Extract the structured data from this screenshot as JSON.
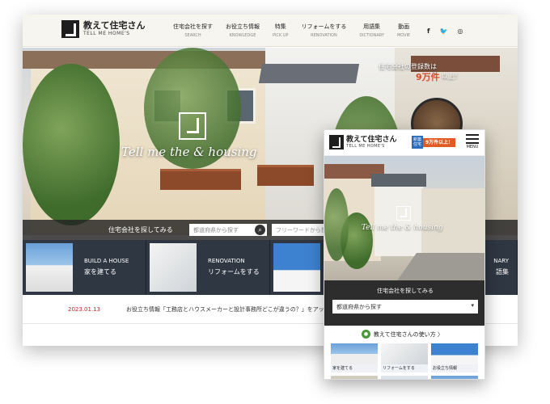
{
  "desktop": {
    "logo": {
      "title": "教えて住宅さん",
      "subtitle": "TELL ME HOME'S"
    },
    "nav": [
      {
        "label": "住宅会社を探す",
        "sub": "SEARCH"
      },
      {
        "label": "お役立ち情報",
        "sub": "KNOWLEDGE"
      },
      {
        "label": "特集",
        "sub": "PICK UP"
      },
      {
        "label": "リフォームをする",
        "sub": "RENOVATION"
      },
      {
        "label": "用語集",
        "sub": "DICTIONARY"
      },
      {
        "label": "動画",
        "sub": "MOVIE"
      }
    ],
    "social": [
      {
        "icon": "facebook-icon",
        "glyph": "f"
      },
      {
        "icon": "twitter-icon",
        "glyph": "🐦"
      },
      {
        "icon": "instagram-icon",
        "glyph": "◎"
      }
    ],
    "hero": {
      "tagline": "Tell me the & housing",
      "ad_line": "住宅会社の登録数は",
      "ad_big": "9万件",
      "ad_tail": "以上！"
    },
    "search": {
      "label": "住宅会社を探してみる",
      "select_placeholder": "都道府県から探す",
      "keyword_placeholder": "フリーワードから探す"
    },
    "categories": [
      {
        "en": "BUILD A HOUSE",
        "jp": "家を建てる"
      },
      {
        "en": "RENOVATION",
        "jp": "リフォームをする"
      },
      {
        "en": "",
        "jp": ""
      },
      {
        "en": "NARY",
        "jp": "語集"
      }
    ],
    "news": {
      "date": "2023.01.13",
      "text": "お役立ち情報「工務店とハウスメーカーと設計事務所どこが違うの？」をアップ"
    }
  },
  "mobile": {
    "logo": {
      "title": "教えて住宅さん",
      "subtitle": "TELL ME HOME'S"
    },
    "badge": {
      "left": "新築 住宅",
      "right": "9万件以上！"
    },
    "menu_label": "MENU",
    "hero": {
      "tagline": "Tell me the & housing"
    },
    "search": {
      "label": "住宅会社を探してみる",
      "select": "都道府県から探す"
    },
    "guide": "教えて住宅さんの使い方 〉",
    "tiles": [
      {
        "label": "家を建てる"
      },
      {
        "label": "リフォームをする"
      },
      {
        "label": "お役立ち情報"
      },
      {
        "label": ""
      },
      {
        "label": ""
      },
      {
        "label": ""
      }
    ]
  }
}
